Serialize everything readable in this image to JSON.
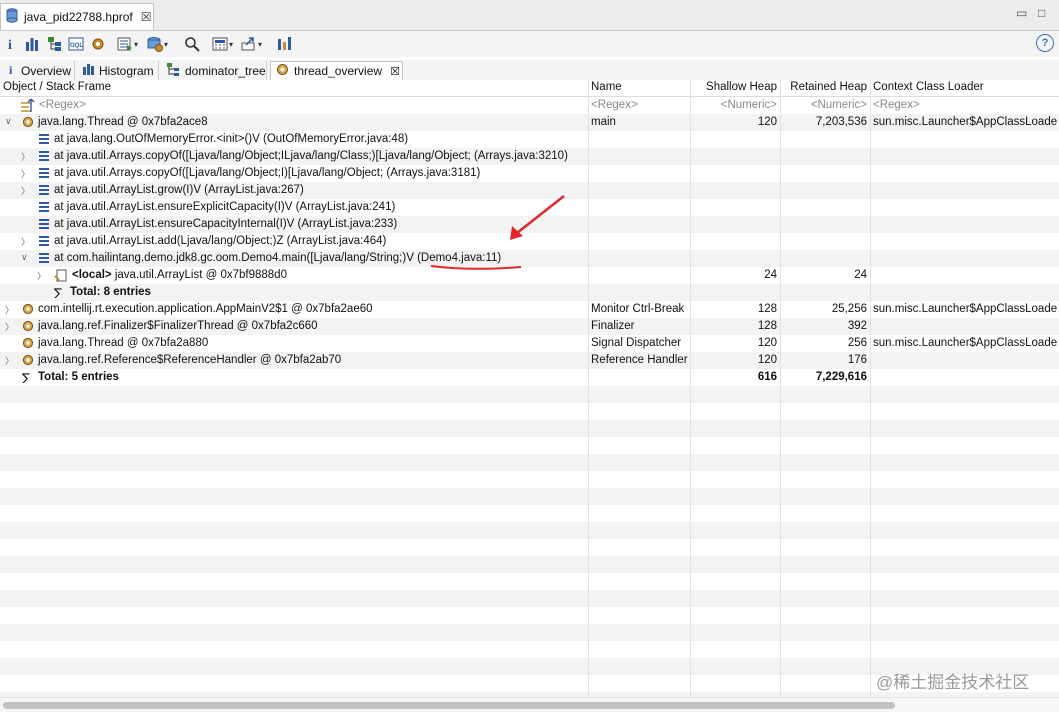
{
  "editor_tab": {
    "title": "java_pid22788.hprof",
    "close": "☒"
  },
  "window_controls": {
    "minimize": "▭",
    "maximize": "□"
  },
  "toolbar": {
    "items": [
      "info-icon",
      "histogram-icon",
      "dominator-tree-icon",
      "oql-icon",
      "settings-icon",
      "run-report-icon",
      "heap-dump-icon",
      "search-icon",
      "calculator-icon",
      "export-icon",
      "group-icon"
    ],
    "help": "?"
  },
  "view_tabs": [
    {
      "label": "Overview",
      "icon": "info-icon",
      "active": false
    },
    {
      "label": "Histogram",
      "icon": "histogram-icon",
      "active": false
    },
    {
      "label": "dominator_tree",
      "icon": "dominator-tree-icon",
      "active": false
    },
    {
      "label": "thread_overview",
      "icon": "thread-gear-icon",
      "active": true
    }
  ],
  "table": {
    "columns": [
      "Object / Stack Frame",
      "Name",
      "Shallow Heap",
      "Retained Heap",
      "Context Class Loader"
    ],
    "filters": [
      "<Regex>",
      "<Regex>",
      "<Numeric>",
      "<Numeric>",
      "<Regex>"
    ],
    "rows": [
      {
        "indent": 0,
        "twisty": "open",
        "icon": "thread",
        "text": "java.lang.Thread @ 0x7bfa2ace8",
        "name": "main",
        "shallow": "120",
        "retained": "7,203,536",
        "loader": "sun.misc.Launcher$AppClassLoade"
      },
      {
        "indent": 1,
        "twisty": "",
        "icon": "frame",
        "text": "at java.lang.OutOfMemoryError.<init>()V (OutOfMemoryError.java:48)"
      },
      {
        "indent": 1,
        "twisty": "closed",
        "icon": "frame",
        "text": "at java.util.Arrays.copyOf([Ljava/lang/Object;ILjava/lang/Class;)[Ljava/lang/Object; (Arrays.java:3210)"
      },
      {
        "indent": 1,
        "twisty": "closed",
        "icon": "frame",
        "text": "at java.util.Arrays.copyOf([Ljava/lang/Object;I)[Ljava/lang/Object; (Arrays.java:3181)"
      },
      {
        "indent": 1,
        "twisty": "closed",
        "icon": "frame",
        "text": "at java.util.ArrayList.grow(I)V (ArrayList.java:267)"
      },
      {
        "indent": 1,
        "twisty": "",
        "icon": "frame",
        "text": "at java.util.ArrayList.ensureExplicitCapacity(I)V (ArrayList.java:241)"
      },
      {
        "indent": 1,
        "twisty": "",
        "icon": "frame",
        "text": "at java.util.ArrayList.ensureCapacityInternal(I)V (ArrayList.java:233)"
      },
      {
        "indent": 1,
        "twisty": "closed",
        "icon": "frame",
        "text": "at java.util.ArrayList.add(Ljava/lang/Object;)Z (ArrayList.java:464)"
      },
      {
        "indent": 1,
        "twisty": "open",
        "icon": "frame",
        "text": "at com.hailintang.demo.jdk8.gc.oom.Demo4.main([Ljava/lang/String;)V (Demo4.java:11)"
      },
      {
        "indent": 2,
        "twisty": "closed",
        "icon": "local",
        "bold_prefix": "<local>",
        "text": " java.util.ArrayList @ 0x7bf9888d0",
        "shallow": "24",
        "retained": "24"
      },
      {
        "indent": 2,
        "twisty": "",
        "icon": "sum",
        "text": "Total: 8 entries",
        "bold": true
      },
      {
        "indent": 0,
        "twisty": "closed",
        "icon": "thread",
        "text": "com.intellij.rt.execution.application.AppMainV2$1 @ 0x7bfa2ae60",
        "name": "Monitor Ctrl-Break",
        "shallow": "128",
        "retained": "25,256",
        "loader": "sun.misc.Launcher$AppClassLoade"
      },
      {
        "indent": 0,
        "twisty": "closed",
        "icon": "thread",
        "text": "java.lang.ref.Finalizer$FinalizerThread @ 0x7bfa2c660",
        "name": "Finalizer",
        "shallow": "128",
        "retained": "392"
      },
      {
        "indent": 0,
        "twisty": "",
        "icon": "thread",
        "text": "java.lang.Thread @ 0x7bfa2a880",
        "name": "Signal Dispatcher",
        "shallow": "120",
        "retained": "256",
        "loader": "sun.misc.Launcher$AppClassLoade"
      },
      {
        "indent": 0,
        "twisty": "closed",
        "icon": "thread",
        "text": "java.lang.ref.Reference$ReferenceHandler @ 0x7bfa2ab70",
        "name": "Reference Handler",
        "shallow": "120",
        "retained": "176"
      },
      {
        "indent": 0,
        "twisty": "",
        "icon": "sum",
        "text": "Total: 5 entries",
        "bold": true,
        "shallow": "616",
        "retained": "7,229,616",
        "bold_nums": true
      }
    ]
  },
  "watermark": "@稀土掘金技术社区",
  "colors": {
    "annotation": "#e3262a",
    "frame_icon": "#2d5a9e",
    "thread_icon": "#b07a2a"
  }
}
